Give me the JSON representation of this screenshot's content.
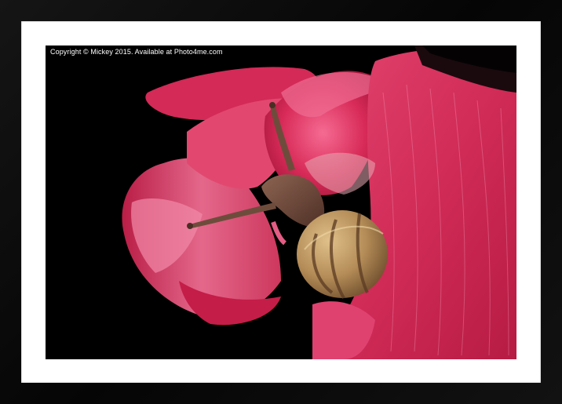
{
  "photo": {
    "copyright": "Copyright © Mickey  2015. Available at Photo4me.com"
  },
  "colors": {
    "frame": "#0b0b0b",
    "mount": "#ffffff",
    "petal": "#e0305f",
    "petal_light": "#f28aa8",
    "background": "#000000",
    "snail_shell": "#b08a55",
    "snail_body": "#6e4c3c"
  },
  "subject": {
    "icon": "snail-on-flower-photo"
  }
}
